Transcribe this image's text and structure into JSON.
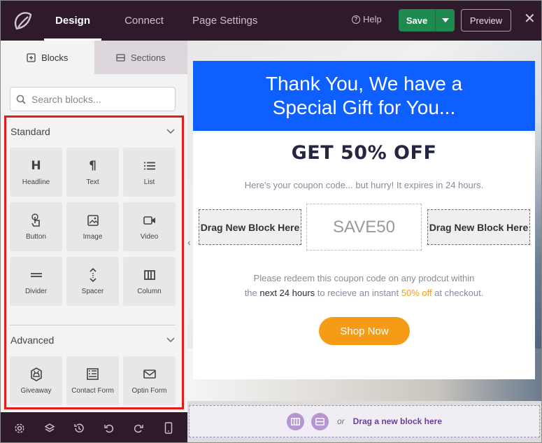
{
  "topbar": {
    "tabs": [
      {
        "label": "Design",
        "active": true
      },
      {
        "label": "Connect",
        "active": false
      },
      {
        "label": "Page Settings",
        "active": false
      }
    ],
    "help_label": "Help",
    "save_label": "Save",
    "preview_label": "Preview",
    "close_label": "✕"
  },
  "sidebar": {
    "tabs": [
      {
        "label": "Blocks",
        "icon": "blocks-icon",
        "active": true
      },
      {
        "label": "Sections",
        "icon": "sections-icon",
        "active": false
      }
    ],
    "search": {
      "placeholder": "Search blocks..."
    },
    "standard": {
      "title": "Standard",
      "blocks": [
        {
          "label": "Headline",
          "icon": "headline-icon"
        },
        {
          "label": "Text",
          "icon": "text-icon"
        },
        {
          "label": "List",
          "icon": "list-icon"
        },
        {
          "label": "Button",
          "icon": "button-icon"
        },
        {
          "label": "Image",
          "icon": "image-icon"
        },
        {
          "label": "Video",
          "icon": "video-icon"
        },
        {
          "label": "Divider",
          "icon": "divider-icon"
        },
        {
          "label": "Spacer",
          "icon": "spacer-icon"
        },
        {
          "label": "Column",
          "icon": "column-icon"
        }
      ]
    },
    "advanced": {
      "title": "Advanced",
      "blocks": [
        {
          "label": "Giveaway",
          "icon": "giveaway-icon"
        },
        {
          "label": "Contact Form",
          "icon": "contact-form-icon"
        },
        {
          "label": "Optin Form",
          "icon": "optin-form-icon"
        }
      ]
    },
    "highlight_color": "#e21b1b"
  },
  "bottombar": {
    "icons": [
      "settings-icon",
      "layers-icon",
      "history-icon",
      "undo-icon",
      "redo-icon",
      "mobile-preview-icon"
    ]
  },
  "canvas": {
    "header_line1": "Thank You, We have a",
    "header_line2": "Special Gift for You...",
    "headline": "GET 50% OFF",
    "subtext": "Here's your coupon code... but hurry! It expires in 24 hours.",
    "drop_left": "Drag New Block Here",
    "coupon_code": "SAVE50",
    "drop_right": "Drag New Block Here",
    "redeem_line1": "Please redeem this coupon code on any prodcut within",
    "redeem_the": "the ",
    "redeem_next": "next 24 hours",
    "redeem_mid": " to recieve an instant ",
    "redeem_off": "50% off",
    "redeem_end": " at checkout.",
    "shop_label": "Shop Now",
    "drag_or": "or",
    "drag_link": "Drag a new block here"
  },
  "colors": {
    "topbar_bg": "#2f1a2c",
    "save_green": "#1f8a4f",
    "header_blue": "#0d5fff",
    "accent_orange": "#f59b16",
    "drag_purple": "#6b3f96"
  }
}
